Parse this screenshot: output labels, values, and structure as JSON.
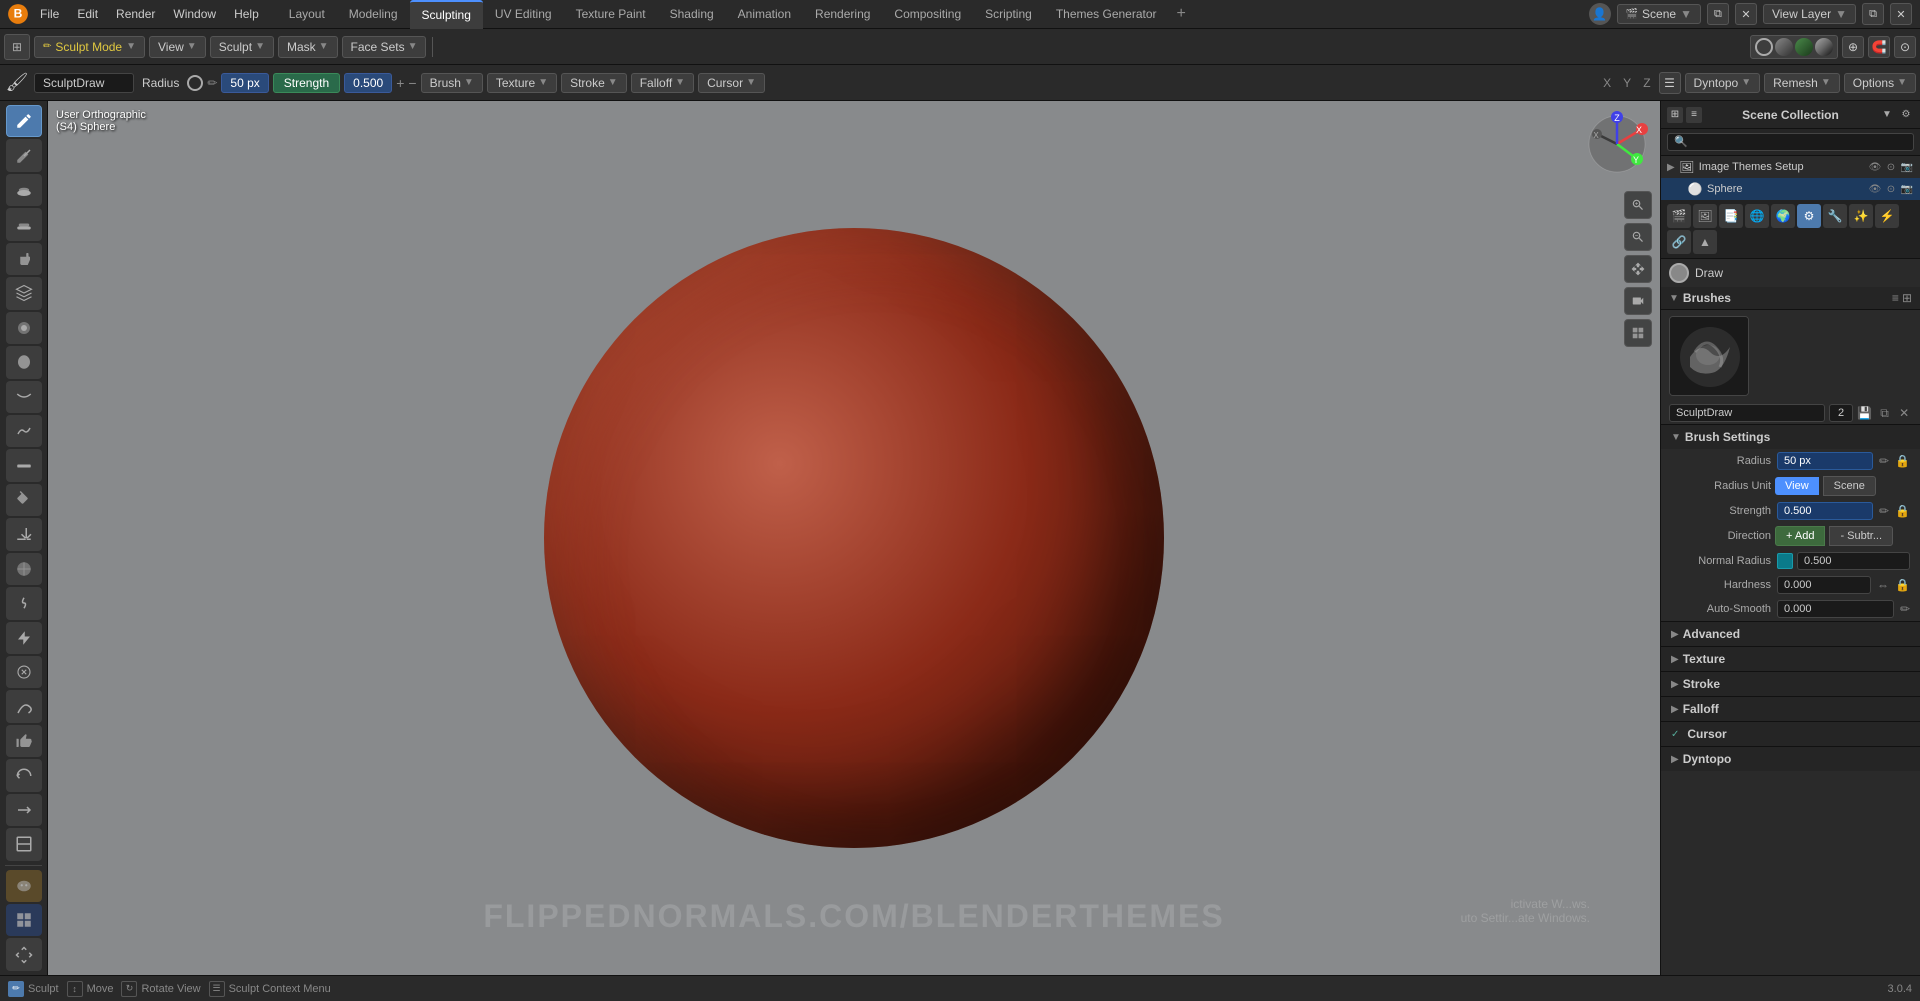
{
  "topMenu": {
    "menuItems": [
      "File",
      "Edit",
      "Render",
      "Window",
      "Help"
    ],
    "workspaceTabs": [
      "Layout",
      "Modeling",
      "Sculpting",
      "UV Editing",
      "Texture Paint",
      "Shading",
      "Animation",
      "Rendering",
      "Compositing",
      "Scripting",
      "Themes Generator"
    ],
    "activeTab": "Sculpting",
    "sceneLabel": "Scene",
    "viewLayerLabel": "View Layer"
  },
  "toolbar": {
    "modeLabel": "Sculpt Mode",
    "viewLabel": "View",
    "sculptLabel": "Sculpt",
    "maskLabel": "Mask",
    "faceSetsLabel": "Face Sets"
  },
  "headerRow": {
    "brushName": "SculptDraw",
    "radiusLabel": "Radius",
    "radiusValue": "50 px",
    "strengthLabel": "Strength",
    "strengthValue": "0.500",
    "brushDropdown": "Brush",
    "textureDropdown": "Texture",
    "strokeDropdown": "Stroke",
    "falloffDropdown": "Falloff",
    "cursorDropdown": "Cursor",
    "dyntopoLabel": "Dyntopo",
    "remeshLabel": "Remesh",
    "optionsLabel": "Options",
    "xLabel": "X",
    "yLabel": "Y",
    "zLabel": "Z"
  },
  "viewport": {
    "viewMode": "User Orthographic",
    "objectName": "(S4) Sphere",
    "watermark": "FLIPPEDNORMALS.COM/BLENDERTHEMES"
  },
  "rightPanel": {
    "sceneCollectionTitle": "Scene Collection",
    "searchPlaceholder": "🔍",
    "outlinerItems": [
      {
        "name": "Image Themes Setup",
        "indent": 0,
        "icon": "🖼",
        "type": "collection"
      },
      {
        "name": "Sphere",
        "indent": 1,
        "icon": "⚪",
        "type": "object",
        "selected": true
      }
    ],
    "drawLabel": "Draw",
    "brushesTitle": "Brushes",
    "brushSettings": {
      "title": "Brush Settings",
      "brushName": "SculptDraw",
      "brushNum": "2",
      "radiusLabel": "Radius",
      "radiusValue": "50 px",
      "radiusUnitLabel": "Radius Unit",
      "viewBtnLabel": "View",
      "sceneBtnLabel": "Scene",
      "strengthLabel": "Strength",
      "strengthValue": "0.500",
      "directionLabel": "Direction",
      "addBtnLabel": "+ Add",
      "subtrBtnLabel": "- Subtr...",
      "normalRadiusLabel": "Normal Radius",
      "normalRadiusValue": "0.500",
      "hardnessLabel": "Hardness",
      "hardnessValue": "0.000",
      "autoSmoothLabel": "Auto-Smooth",
      "autoSmoothValue": "0.000"
    },
    "sections": [
      {
        "title": "Advanced",
        "expanded": false
      },
      {
        "title": "Texture",
        "expanded": false
      },
      {
        "title": "Stroke",
        "expanded": false
      },
      {
        "title": "Falloff",
        "expanded": false
      },
      {
        "title": "Cursor",
        "expanded": false
      },
      {
        "title": "Dyntopo",
        "expanded": false
      }
    ]
  },
  "statusBar": {
    "sculptLabel": "Sculpt",
    "moveLabel": "Move",
    "rotateLabel": "Rotate View",
    "contextLabel": "Sculpt Context Menu",
    "versionLabel": "3.0.4"
  }
}
